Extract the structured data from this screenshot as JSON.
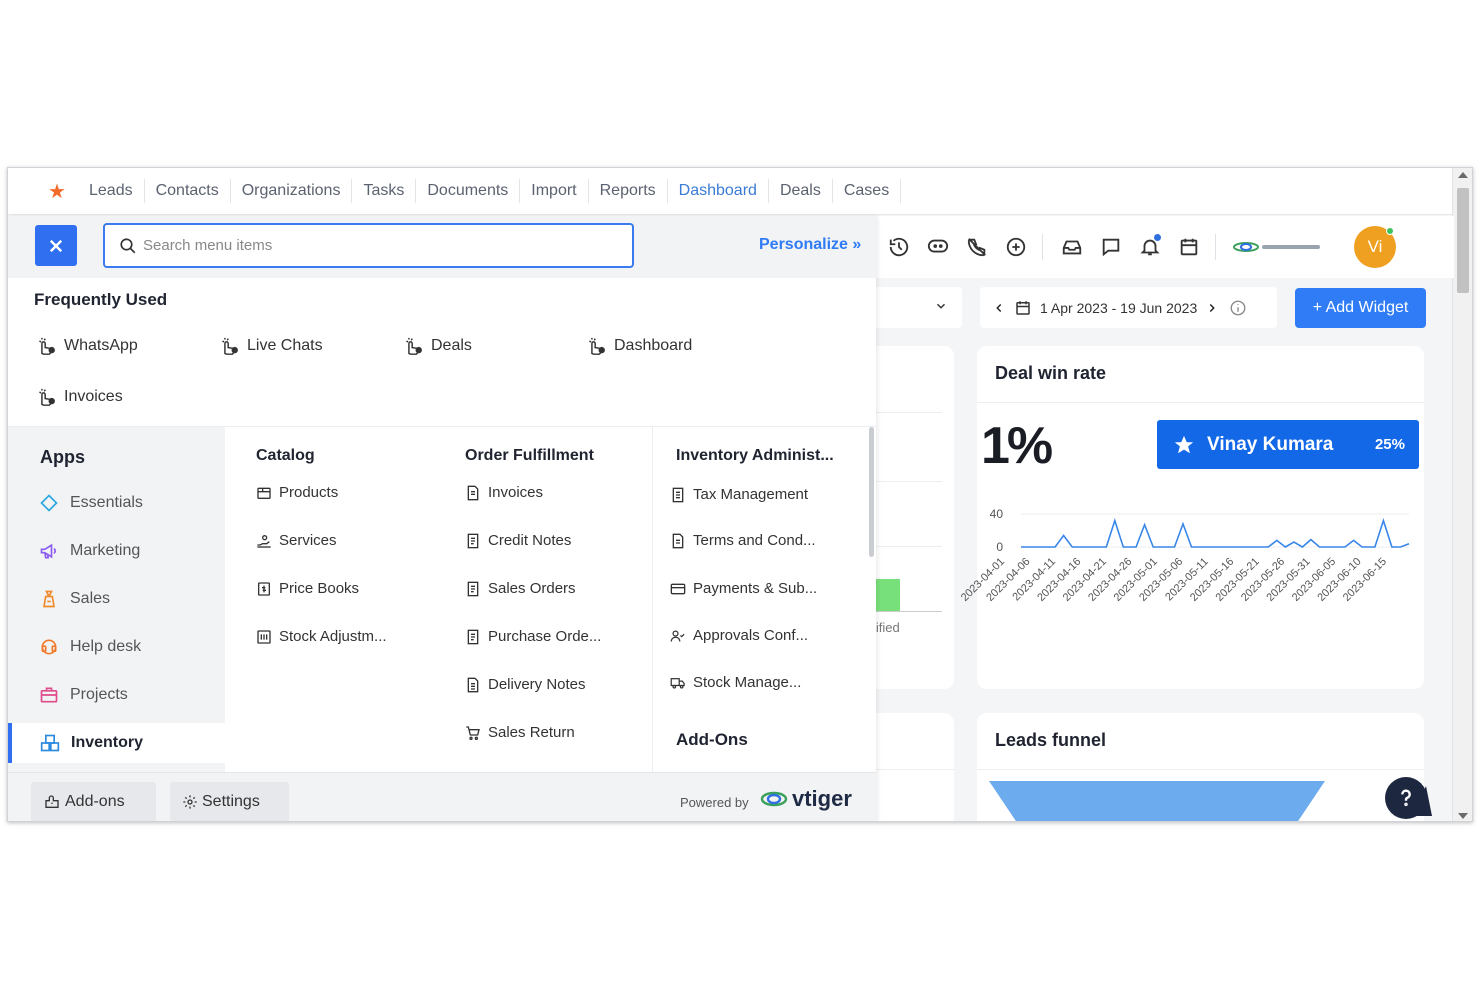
{
  "topnav": {
    "tabs": [
      "Leads",
      "Contacts",
      "Organizations",
      "Tasks",
      "Documents",
      "Import",
      "Reports",
      "Dashboard",
      "Deals",
      "Cases"
    ],
    "active_tab": "Dashboard"
  },
  "menu": {
    "search_placeholder": "Search menu items",
    "personalize_label": "Personalize »",
    "frequently_used_title": "Frequently Used",
    "frequently_used": [
      "WhatsApp",
      "Live Chats",
      "Deals",
      "Dashboard",
      "Invoices"
    ],
    "apps_title": "Apps",
    "apps": [
      {
        "label": "Essentials",
        "icon": "diamond-icon",
        "color": "#2aa7e0"
      },
      {
        "label": "Marketing",
        "icon": "megaphone-icon",
        "color": "#8a5cf0"
      },
      {
        "label": "Sales",
        "icon": "sales-icon",
        "color": "#f08a2a"
      },
      {
        "label": "Help desk",
        "icon": "headset-icon",
        "color": "#f07a2a"
      },
      {
        "label": "Projects",
        "icon": "briefcase-icon",
        "color": "#e04a8a"
      },
      {
        "label": "Inventory",
        "icon": "boxes-icon",
        "color": "#2a8ae0"
      }
    ],
    "active_app": "Inventory",
    "catalog": {
      "title": "Catalog",
      "items": [
        "Products",
        "Services",
        "Price Books",
        "Stock Adjustm..."
      ]
    },
    "order_fulfillment": {
      "title": "Order Fulfillment",
      "items": [
        "Invoices",
        "Credit Notes",
        "Sales Orders",
        "Purchase Orde...",
        "Delivery Notes",
        "Sales Return"
      ]
    },
    "inventory_admin": {
      "title": "Inventory Administ...",
      "items": [
        "Tax Management",
        "Terms and Cond...",
        "Payments & Sub...",
        "Approvals Conf...",
        "Stock Manage..."
      ]
    },
    "addons_title": "Add-Ons",
    "footer": {
      "addons_label": "Add-ons",
      "settings_label": "Settings",
      "powered_by": "Powered by",
      "brand": "vtiger"
    }
  },
  "toolbar": {
    "avatar_initials": "Vi",
    "avatar_color": "#f0a020"
  },
  "filters": {
    "date_range": "1 Apr 2023 - 19 Jun 2023",
    "add_widget_label": "+ Add Widget"
  },
  "left_card": {
    "partial_label": "lified"
  },
  "deal_win_rate": {
    "title": "Deal win rate",
    "percent": "1%",
    "leader_name": "Vinay Kumara",
    "leader_pct": "25%",
    "chart_data": {
      "type": "line",
      "ylim": [
        0,
        40
      ],
      "yticks": [
        40,
        0
      ],
      "x": [
        "2023-04-01",
        "2023-04-06",
        "2023-04-11",
        "2023-04-16",
        "2023-04-21",
        "2023-04-26",
        "2023-05-01",
        "2023-05-06",
        "2023-05-11",
        "2023-05-16",
        "2023-05-21",
        "2023-05-26",
        "2023-05-31",
        "2023-06-05",
        "2023-06-10",
        "2023-06-15"
      ],
      "series": [
        {
          "values": [
            [
              0,
              0
            ],
            [
              8,
              0
            ],
            [
              10,
              14
            ],
            [
              12,
              0
            ],
            [
              20,
              0
            ],
            [
              22,
              32
            ],
            [
              24,
              0
            ],
            [
              27,
              0
            ],
            [
              29,
              27
            ],
            [
              31,
              0
            ],
            [
              36,
              0
            ],
            [
              38,
              28
            ],
            [
              40,
              0
            ],
            [
              58,
              0
            ],
            [
              60,
              8
            ],
            [
              62,
              0
            ],
            [
              64,
              6
            ],
            [
              66,
              0
            ],
            [
              68,
              9
            ],
            [
              70,
              0
            ],
            [
              76,
              0
            ],
            [
              78,
              8
            ],
            [
              80,
              0
            ],
            [
              83,
              0
            ],
            [
              85,
              32
            ],
            [
              87,
              0
            ],
            [
              89,
              0
            ],
            [
              91,
              4
            ]
          ]
        }
      ],
      "line_color": "#3a86e8"
    }
  },
  "leads_funnel": {
    "title": "Leads funnel",
    "funnel_color": "#6cabee"
  }
}
